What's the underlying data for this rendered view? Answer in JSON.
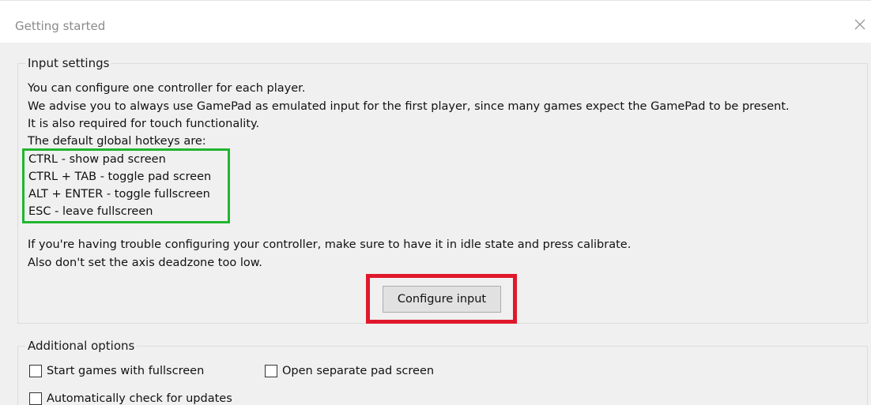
{
  "window": {
    "title": "Getting started"
  },
  "input_settings": {
    "legend": "Input settings",
    "intro_lines": [
      "You can configure one controller for each player.",
      "We advise you to always use GamePad as emulated input for the first player, since many games expect the GamePad to be present.",
      "It is also required for touch functionality.",
      "The default global hotkeys are:"
    ],
    "hotkeys": [
      "CTRL - show pad screen",
      "CTRL + TAB - toggle pad screen",
      "ALT + ENTER - toggle fullscreen",
      "ESC - leave fullscreen"
    ],
    "trouble_lines": [
      "If you're having trouble configuring your controller, make sure to have it in idle state and press calibrate.",
      "Also don't set the axis deadzone too low."
    ],
    "configure_button_label": "Configure input"
  },
  "additional_options": {
    "legend": "Additional options",
    "checkboxes": [
      {
        "label": "Start games with fullscreen",
        "checked": false
      },
      {
        "label": "Open separate pad screen",
        "checked": false
      },
      {
        "label": "Automatically check for updates",
        "checked": false
      }
    ]
  },
  "colors": {
    "hotkey_highlight": "#21b530",
    "button_highlight": "#e0182c"
  }
}
